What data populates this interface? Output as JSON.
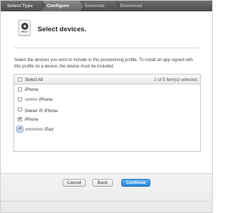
{
  "steps": [
    {
      "label": "Select Type",
      "state": "done"
    },
    {
      "label": "Configure",
      "state": "active"
    },
    {
      "label": "Generate",
      "state": "pending"
    },
    {
      "label": "Download",
      "state": "pending"
    }
  ],
  "header": {
    "icon_label": "PROV",
    "title": "Select devices."
  },
  "description": "Select the devices you wish to include in this provisioning profile. To install an app signed with this profile on a device, the device must be included.",
  "table": {
    "select_all_label": "Select All",
    "selection_count": "2  of 5 item(s) selected",
    "rows": [
      {
        "name": "iPhone",
        "checked": false
      },
      {
        "name": "iPhone",
        "checked": false
      },
      {
        "name": "Owner の iPhone",
        "checked": false
      },
      {
        "name": "iPhone",
        "checked": true
      },
      {
        "name": "iPad",
        "checked": true
      }
    ]
  },
  "buttons": {
    "cancel": "Cancel",
    "back": "Back",
    "continue": "Continue"
  },
  "colors": {
    "primary_button": "#2c86d9",
    "step_bar": "#4a4a4a"
  }
}
